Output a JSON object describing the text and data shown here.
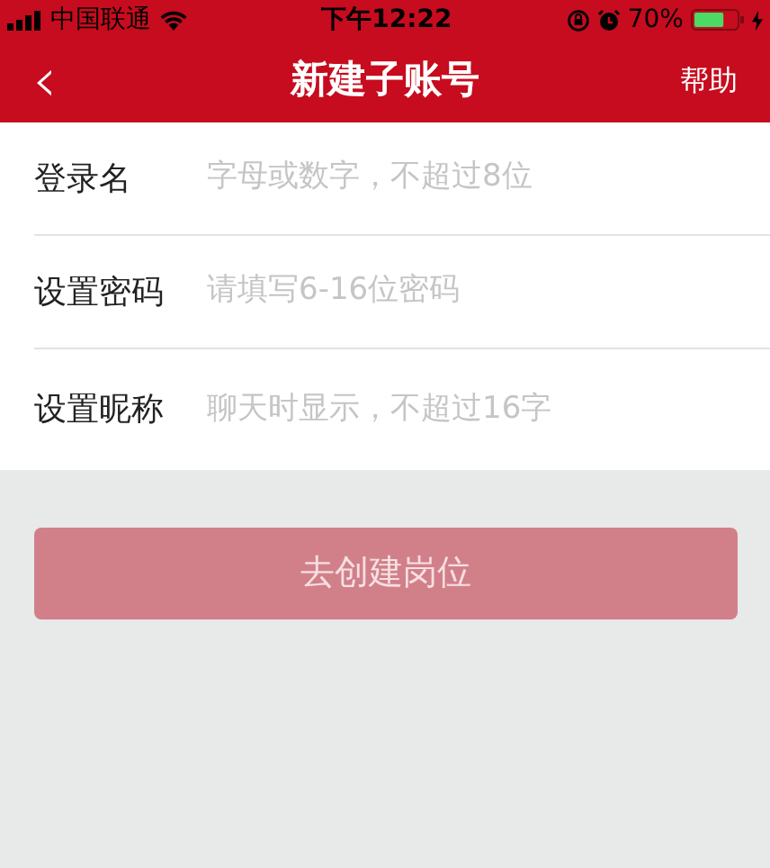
{
  "status_bar": {
    "carrier": "中国联通",
    "time": "下午12:22",
    "battery_text": "70%",
    "battery": {
      "level": 0.7,
      "charging": true
    }
  },
  "nav": {
    "back": "‹",
    "title": "新建子账号",
    "action": "帮助"
  },
  "fields": [
    {
      "label": "登录名",
      "placeholder": "字母或数字，不超过8位"
    },
    {
      "label": "设置密码",
      "placeholder": "请填写6-16位密码"
    },
    {
      "label": "设置昵称",
      "placeholder": "聊天时显示，不超过16字"
    }
  ],
  "submit": {
    "label": "去创建岗位",
    "disabled": true
  }
}
